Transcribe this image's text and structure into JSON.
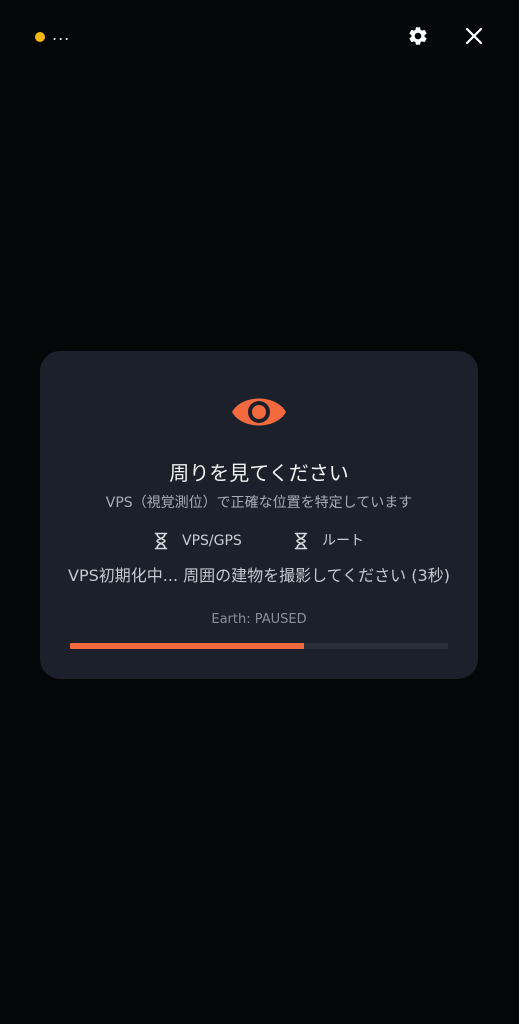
{
  "status": {
    "indicator_color": "#f5b812",
    "text": "..."
  },
  "toolbar": {
    "settings_icon": "gear-icon",
    "close_icon": "close-icon"
  },
  "card": {
    "icon": "eye-icon",
    "accent_color": "#f26a3d",
    "title": "周りを見てください",
    "subtitle": "VPS（視覚測位）で正確な位置を特定しています",
    "status_items": [
      {
        "icon": "hourglass-icon",
        "label": "VPS/GPS"
      },
      {
        "icon": "hourglass-icon",
        "label": "ルート"
      }
    ],
    "message": "VPS初期化中... 周囲の建物を撮影してください (3秒)",
    "earth_status": "Earth: PAUSED",
    "progress": 0.62
  }
}
